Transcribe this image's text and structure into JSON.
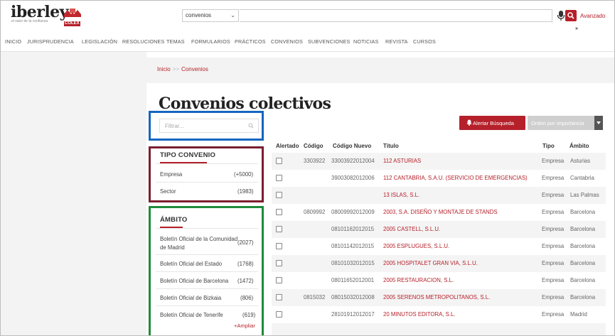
{
  "header": {
    "logo_text": "iberley",
    "logo_tagline": "el valor de la confianza",
    "logo_brand": "COLEX",
    "search_select": "convenios",
    "search_value": "",
    "advanced_label": "Avanzado",
    "more_label": "»"
  },
  "nav": [
    "INICIO",
    "JURISPRUDENCIA",
    "LEGISLACIÓN",
    "RESOLUCIONES",
    "TEMAS",
    "FORMULARIOS",
    "PRÁCTICOS",
    "CONVENIOS",
    "SUBVENCIONES",
    "NOTICIAS",
    "REVISTA",
    "CURSOS"
  ],
  "breadcrumb": {
    "home": "Inicio",
    "sep": ">>",
    "current": "Convenios"
  },
  "page_title": "Convenios colectivos",
  "filter": {
    "placeholder": "Filtrar..."
  },
  "facets": {
    "tipo": {
      "title": "TIPO CONVENIO",
      "items": [
        {
          "label": "Empresa",
          "count": "(+5000)"
        },
        {
          "label": "Sector",
          "count": "(1983)"
        }
      ]
    },
    "ambito": {
      "title": "ÁMBITO",
      "items": [
        {
          "label": "Boletín Oficial de la Comunidad de Madrid",
          "count": "(2027)"
        },
        {
          "label": "Boletín Oficial del Estado",
          "count": "(1768)"
        },
        {
          "label": "Boletín Oficial de Barcelona",
          "count": "(1472)"
        },
        {
          "label": "Boletín Oficial de Bizkaia",
          "count": "(806)"
        },
        {
          "label": "Boletín Oficial de Tenerife",
          "count": "(619)"
        }
      ],
      "more_label": "Ampliar"
    }
  },
  "actions": {
    "alert": "Alertar Búsqueda",
    "order": "Orden por importancia"
  },
  "table": {
    "headers": {
      "alertado": "Alertado",
      "codigo": "Código",
      "nuevo": "Código Nuevo",
      "titulo": "Título",
      "tipo": "Tipo",
      "ambito": "Ámbito"
    },
    "rows": [
      {
        "codigo": "3303922",
        "nuevo": "33003922012004",
        "titulo": "112 ASTURIAS",
        "tipo": "Empresa",
        "ambito": "Asturias"
      },
      {
        "codigo": "",
        "nuevo": "39003082012006",
        "titulo": "112 CANTABRIA, S.A.U. (SERVICIO DE EMERGENCIAS)",
        "tipo": "Empresa",
        "ambito": "Cantabria"
      },
      {
        "codigo": "",
        "nuevo": "",
        "titulo": "13 ISLAS, S.L.",
        "tipo": "Empresa",
        "ambito": "Las Palmas"
      },
      {
        "codigo": "0809992",
        "nuevo": "08009992012009",
        "titulo": "2003, S.A. DISEÑO Y MONTAJE DE STANDS",
        "tipo": "Empresa",
        "ambito": "Barcelona"
      },
      {
        "codigo": "",
        "nuevo": "08101162012015",
        "titulo": "2005 CASTELL, S.L.U.",
        "tipo": "Empresa",
        "ambito": "Barcelona"
      },
      {
        "codigo": "",
        "nuevo": "08101142012015",
        "titulo": "2005 ESPLUGUES, S.L.U.",
        "tipo": "Empresa",
        "ambito": "Barcelona"
      },
      {
        "codigo": "",
        "nuevo": "08101032012015",
        "titulo": "2005 HOSPITALET GRAN VIA, S.L.U.",
        "tipo": "Empresa",
        "ambito": "Barcelona"
      },
      {
        "codigo": "",
        "nuevo": "08011652012001",
        "titulo": "2005 RESTAURACION, S.L.",
        "tipo": "Empresa",
        "ambito": "Barcelona"
      },
      {
        "codigo": "0815032",
        "nuevo": "08015032012008",
        "titulo": "2005 SERENOS METROPOLITANOS, S.L.",
        "tipo": "Empresa",
        "ambito": "Barcelona"
      },
      {
        "codigo": "",
        "nuevo": "28101912012017",
        "titulo": "20 MINUTOS EDITORA, S.L.",
        "tipo": "Empresa",
        "ambito": "Madrid"
      }
    ]
  },
  "colors": {
    "accent": "#b5202a",
    "annotation_blue": "#1565c0",
    "annotation_red": "#7b1e2e",
    "annotation_green": "#1e8b3a"
  },
  "icons": [
    "colex-logo-icon",
    "chevron-down-icon",
    "microphone-icon",
    "search-icon",
    "bell-icon",
    "plus-icon",
    "checkbox-icon"
  ]
}
